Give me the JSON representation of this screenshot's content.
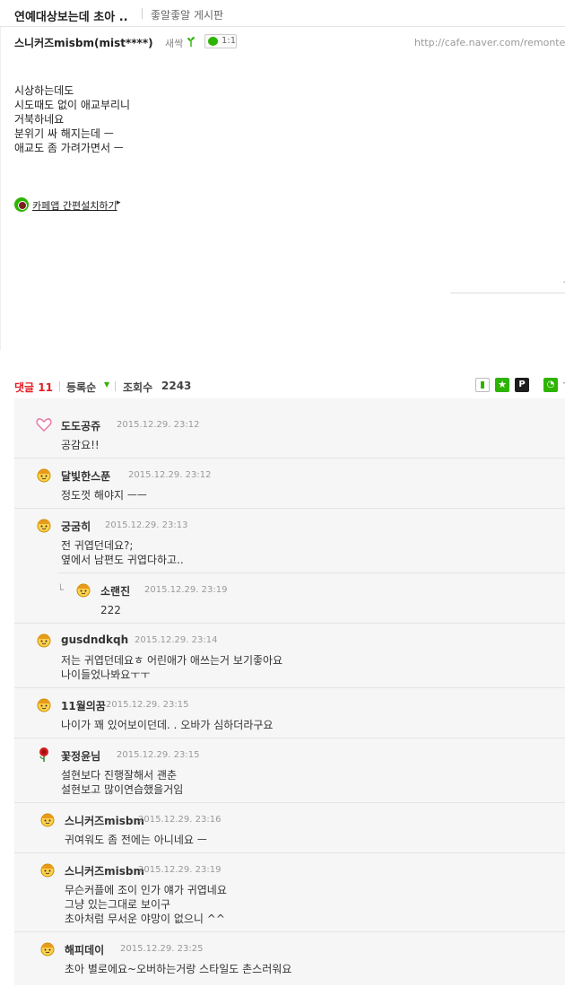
{
  "post": {
    "title": "연예대상보는데 초아 ..",
    "board": "좋알좋알 게시판",
    "author": "스니커즈misbm(mist****)",
    "level": "새싹",
    "chat_label": "1:1",
    "url": "http://cafe.naver.com/remonter",
    "body": [
      "시상하는데도",
      "시도때도 없이 애교부리니",
      "거북하네요",
      "분위기 싸 해지는데 ㅡ",
      "애교도 좀 가려가면서 ㅡ"
    ],
    "app_link": "카페앱 간편설치하기"
  },
  "stats": {
    "comments_label": "댓글 11",
    "sort_label": "등록순",
    "views_label": "조회수",
    "views_value": "2243"
  },
  "toolbar_icons": [
    "page-icon",
    "star-icon",
    "p-icon",
    "rss-icon"
  ],
  "comments": [
    {
      "nick": "도도공쥬",
      "date": "2015.12.29. 23:12",
      "avatar": "heart-icon",
      "lines": [
        "공감요!!"
      ]
    },
    {
      "nick": "달빛한스푼",
      "date": "2015.12.29. 23:12",
      "avatar": "face-icon",
      "lines": [
        "정도껏 해야지 ㅡㅡ"
      ]
    },
    {
      "nick": "궁굼히",
      "date": "2015.12.29. 23:13",
      "avatar": "face-icon",
      "lines": [
        "전 귀엽던데요?;",
        "옆에서 남편도 귀엽다하고.."
      ]
    },
    {
      "nick": "소랜진",
      "date": "2015.12.29. 23:19",
      "avatar": "face-icon",
      "reply": true,
      "lines": [
        "222"
      ]
    },
    {
      "nick": "gusdndkqh",
      "date": "2015.12.29. 23:14",
      "avatar": "face-icon",
      "lines": [
        "저는 귀엽던데요ㅎ 어린애가 애쓰는거 보기좋아요",
        "나이들었나봐요ㅜㅜ"
      ]
    },
    {
      "nick": "11월의꿈",
      "date": "2015.12.29. 23:15",
      "avatar": "face-icon",
      "lines": [
        "나이가 꽤 있어보이던데. . 오바가 심하더라구요"
      ]
    },
    {
      "nick": "꽃정윤님",
      "date": "2015.12.29. 23:15",
      "avatar": "rose-icon",
      "lines": [
        "설현보다 진행잘해서 괜춘",
        "설현보고 많이연습했을거임"
      ]
    },
    {
      "nick": "스니커즈misbm",
      "date": "2015.12.29. 23:16",
      "avatar": "face-icon",
      "lines": [
        "귀여워도 좀 전에는 아니네요 ㅡ"
      ]
    },
    {
      "nick": "스니커즈misbm",
      "date": "2015.12.29. 23:19",
      "avatar": "face-icon",
      "lines": [
        "무슨커플에 조이 인가 얘가 귀엽네요",
        "그냥 있는그대로 보이구",
        "초아처럼 무서운 야망이 없으니 ^^"
      ]
    },
    {
      "nick": "해피데이",
      "date": "2015.12.29. 23:25",
      "avatar": "face-icon",
      "lines": [
        "초아 별로에요~오버하는거랑 스타일도 촌스러워요"
      ]
    }
  ]
}
